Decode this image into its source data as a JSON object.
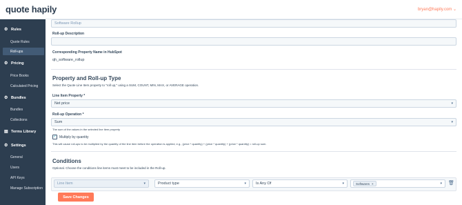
{
  "header": {
    "logo_main": "quote hapily",
    "user_email": "bryan@hapily.com",
    "user_chevron": "⌄"
  },
  "sidebar": {
    "sections": [
      {
        "label": "Rules",
        "icon": "gear-icon",
        "glyph": "⚙"
      },
      {
        "label": "Pricing",
        "icon": "gear-icon",
        "glyph": "⚙"
      },
      {
        "label": "Bundles",
        "icon": "gear-icon",
        "glyph": "⚙"
      },
      {
        "label": "Terms Library",
        "icon": "book-icon",
        "glyph": "▤"
      },
      {
        "label": "Settings",
        "icon": "gear-icon",
        "glyph": "⚙"
      }
    ],
    "items": [
      {
        "label": "Quote Rules"
      },
      {
        "label": "Roll-ups"
      },
      {
        "label": "Price Books"
      },
      {
        "label": "Calculated Pricing"
      },
      {
        "label": "Bundles"
      },
      {
        "label": "Collections"
      },
      {
        "label": "General"
      },
      {
        "label": "Users"
      },
      {
        "label": "API Keys"
      },
      {
        "label": "Manage Subscription"
      }
    ]
  },
  "form": {
    "name_value": "Software Rollup",
    "description_label": "Roll-up Description",
    "description_value": "",
    "property_name_label": "Corresponding Property Name in HubSpot",
    "property_name_value": "qh_software_rollup",
    "section_property_title": "Property and Roll-up Type",
    "section_property_desc": "Select the Quote Line Item property to \"roll up,\" using a SUM, COUNT, MIN, MAX, or AVERAGE operation.",
    "line_item_property_label": "Line Item Property *",
    "line_item_property_value": "Net price",
    "rollup_operation_label": "Roll-up Operation *",
    "rollup_operation_value": "Sum",
    "operation_hint": "The sum of the values in the selected line item property",
    "multiply_label": "Multiply by quantity",
    "multiply_checked": true,
    "multiply_desc": "This will cause roll-ups to be multiplied by the quantity of the line item before the operation is applied, e.g., (price * quantity) + (price * quantity) + (price * quantity) = roll-up sum.",
    "conditions_title": "Conditions",
    "conditions_desc": "Optional. Choose the conditions line items must meet to be included in the Roll-up.",
    "condition": {
      "object": "Line Item",
      "property": "Product type",
      "operator": "Is Any Of",
      "value_tag": "Softwares",
      "tag_remove": "×"
    },
    "save_label": "Save Changes"
  }
}
